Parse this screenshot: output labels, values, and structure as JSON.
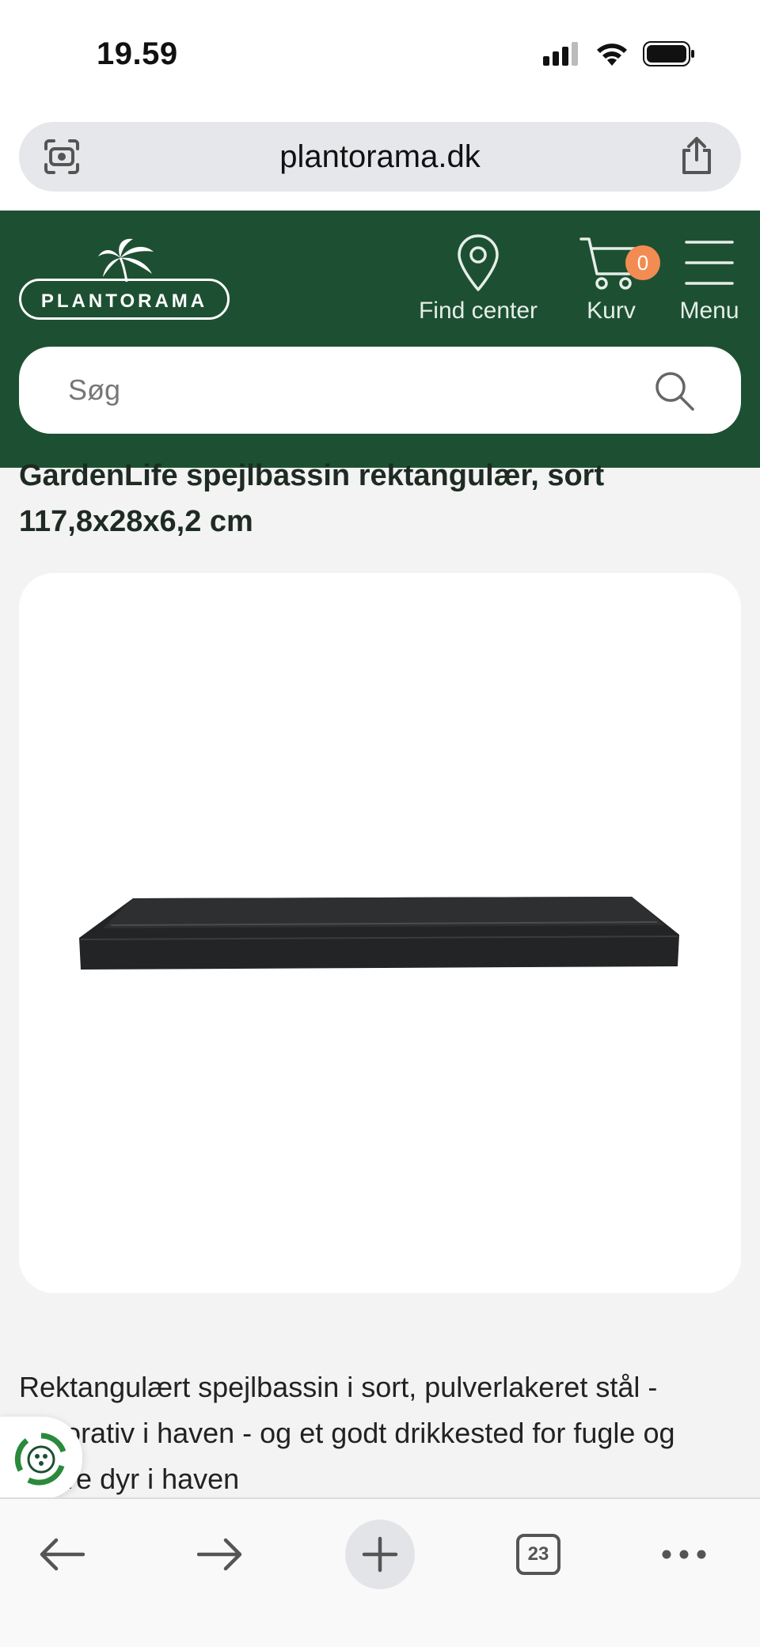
{
  "status_bar": {
    "time": "19.59"
  },
  "browser": {
    "url": "plantorama.dk",
    "tab_count": "23"
  },
  "header": {
    "logo_text": "PLANTORAMA",
    "nav": {
      "find_center": "Find center",
      "cart": "Kurv",
      "cart_count": "0",
      "menu": "Menu"
    },
    "search": {
      "placeholder": "Søg",
      "value": ""
    }
  },
  "product": {
    "title": "GardenLife spejlbassin rektangulær, sort 117,8x28x6,2 cm",
    "description": "Rektangulært spejlbassin i sort, pulverlakeret stål - dekorativ i haven - og et godt drikkested for fugle og andre dyr i haven"
  },
  "colors": {
    "header_green": "#1d5032",
    "badge_orange": "#f28c52",
    "page_bg": "#f3f3f3"
  },
  "icons": {
    "status": [
      "signal-icon",
      "wifi-icon",
      "battery-icon"
    ],
    "toolbar": [
      "back-arrow-icon",
      "forward-arrow-icon",
      "plus-icon",
      "tabs-icon",
      "more-icon"
    ]
  }
}
